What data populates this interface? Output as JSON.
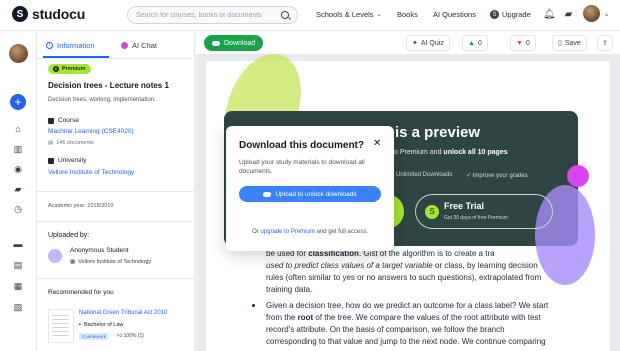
{
  "topbar": {
    "logo_text": "studocu",
    "search_placeholder": "Search for courses, books or documents",
    "nav": {
      "schools_levels": "Schools & Levels",
      "books": "Books",
      "ai_questions": "AI Questions",
      "upgrade": "Upgrade"
    }
  },
  "panel": {
    "tabs": {
      "information": "Information",
      "ai_chat": "AI Chat"
    },
    "premium_badge": "Premium",
    "doc_title": "Decision trees - Lecture notes 1",
    "doc_desc": "Decision trees, working, implementation.",
    "course_label": "Course",
    "course_name": "Machine Learning (CSE4020)",
    "course_docs": "146 documents",
    "university_label": "University",
    "university_name": "Vellore Institute of Technology",
    "academic_year": "Academic year: 2018/2019",
    "uploaded_by_label": "Uploaded by:",
    "uploader_name": "Anonymous Student",
    "uploader_uni": "Vellore Institute of Technology",
    "recommended_label": "Recommended for you",
    "recommended": {
      "title": "National Green Tribunal Act 2010",
      "course": "Bachelor of Law",
      "tag": "Coursework",
      "rating": "100% (1)"
    }
  },
  "toolbar": {
    "download": "Download",
    "ai_quiz": "AI Quiz",
    "likes": "0",
    "dislikes": "0",
    "save": "Save"
  },
  "preview": {
    "title": "is a preview",
    "sub_prefix": "o Premium and",
    "sub_bold": "unlock all 10 pages",
    "feature_1": "Unlimited Downloads",
    "feature_2": "Improve your grades",
    "free_trial_title": "Free Trial",
    "free_trial_sub": "Get 30 days of free Premium"
  },
  "document_text": {
    "line_1_prefix": "be used for ",
    "line_1_bold": "classification",
    "line_1_suffix": ". Gist of the algorithm is to create a tra",
    "line_2_italic": "used to predict class values of a target variable",
    "line_2_suffix": " or class, by learning decision",
    "line_3": "rules (often similar to yes or no answers to such questions), extrapolated from",
    "line_4": "training data.",
    "line_5": "Given a decision tree, how do we predict an outcome for a class label? We start",
    "line_6_prefix": "from the ",
    "line_6_bold": "root",
    "line_6_suffix": " of the tree. We compare the values of the root attribute with test",
    "line_7": "record's attribute. On the basis of comparison, we follow the branch",
    "line_8": "corresponding to that value and jump to the next node. We continue comparing"
  },
  "modal": {
    "title": "Download this document?",
    "text": "Upload your study materials to download all documents.",
    "button": "Upload to unlock downloads",
    "footer_prefix": "Or ",
    "footer_link": "upgrade to Premium",
    "footer_suffix": " and get full access."
  },
  "colors": {
    "brand_blue": "#2563eb",
    "download_green": "#16a34a",
    "premium_lime": "#a3e635",
    "preview_bg": "#2f4543"
  }
}
